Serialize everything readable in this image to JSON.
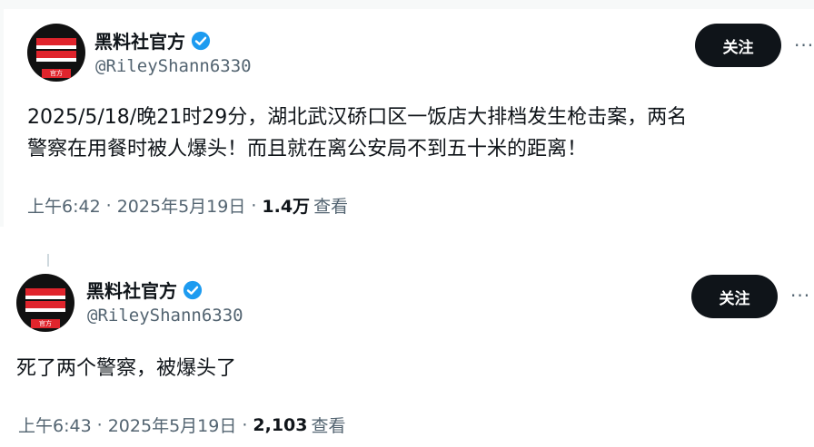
{
  "tweets": [
    {
      "author_name": "黑料社官方",
      "handle": "@RileyShann6330",
      "follow_label": "关注",
      "more_label": "···",
      "avatar_tag": "官方",
      "text_line1": "2025/5/18/晚21时29分，湖北武汉硚口区一饭店大排档发生枪击案，两名",
      "text_line2": "警察在用餐时被人爆头！而且就在离公安局不到五十米的距离！",
      "time": "上午6:42",
      "sep": "·",
      "date": "2025年5月19日",
      "views": "1.4万",
      "views_label": "查看"
    },
    {
      "author_name": "黑料社官方",
      "handle": "@RileyShann6330",
      "follow_label": "关注",
      "more_label": "···",
      "avatar_tag": "官方",
      "text_line1": "死了两个警察，被爆头了",
      "time": "上午6:43",
      "sep": "·",
      "date": "2025年5月19日",
      "views": "2,103",
      "views_label": "查看"
    }
  ],
  "colors": {
    "verified": "#1d9bf0",
    "follow_bg": "#0f1419",
    "muted_text": "#536471"
  }
}
